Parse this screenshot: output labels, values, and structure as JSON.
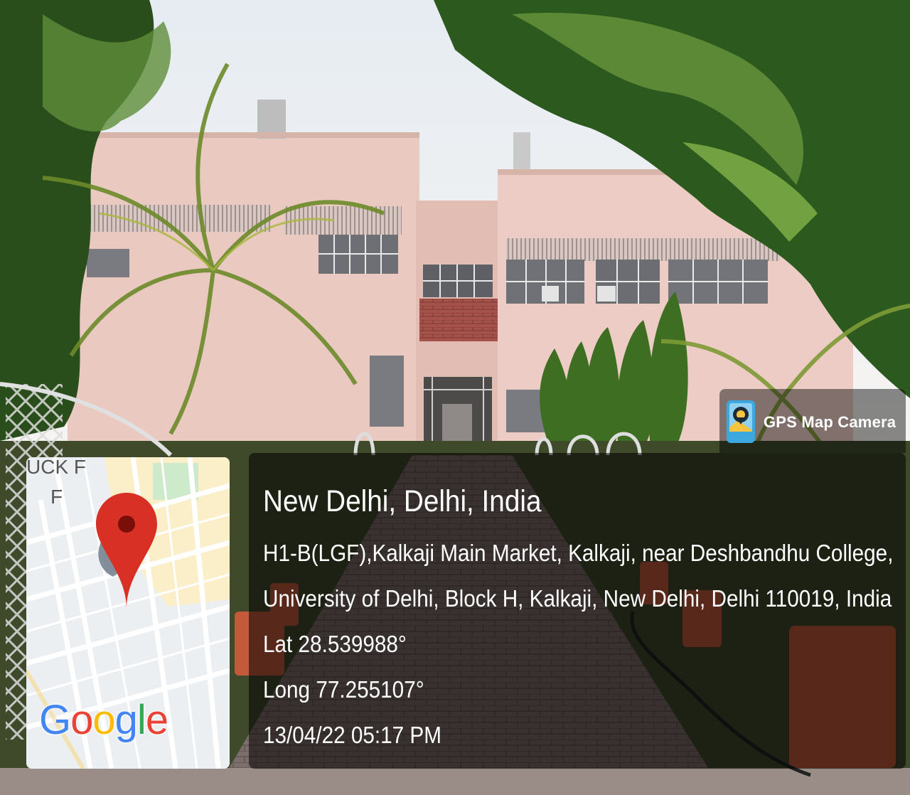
{
  "gps_badge": {
    "label": "GPS Map Camera",
    "icon": "map-camera-icon"
  },
  "location": {
    "title": "New Delhi, Delhi, India",
    "address_line1": "H1-B(LGF),Kalkaji Main Market, Kalkaji, near Deshbandhu College,",
    "address_line2": "University of Delhi, Block H, Kalkaji, New Delhi, Delhi 110019, India",
    "latitude": "Lat 28.539988°",
    "longitude": "Long 77.255107°",
    "timestamp": "13/04/22 05:17 PM"
  },
  "map": {
    "label_top": "UCK F",
    "label_second": "F",
    "pin_icon": "map-pin-icon",
    "logo": "Google",
    "logo_colors": [
      "#4285F4",
      "#EA4335",
      "#FBBC05",
      "#4285F4",
      "#34A853",
      "#EA4335"
    ]
  },
  "colors": {
    "wall": "#e9c9c0",
    "foliage": "#2f5d1e",
    "panel": "#000000",
    "pin": "#d93025"
  }
}
